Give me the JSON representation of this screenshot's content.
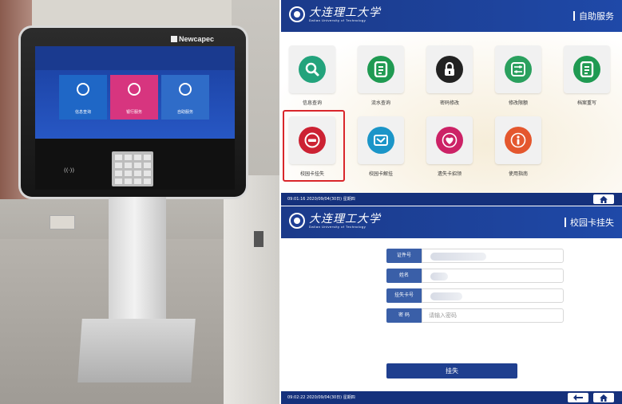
{
  "photo": {
    "brand": "Newcapec",
    "kiosk_tiles": [
      {
        "label": "信息查询",
        "color": "#1f67c6"
      },
      {
        "label": "银行服务",
        "color": "#d7357f"
      },
      {
        "label": "自助服务",
        "color": "#2f6cc8"
      }
    ],
    "nfc_label": "((·))"
  },
  "menu_screen": {
    "header": {
      "logo_cn": "大连理工大学",
      "logo_en": "Dalian University of Technology",
      "right_title": "自助服务"
    },
    "tiles": [
      {
        "label": "信息查询",
        "icon": "search-icon",
        "color": "#23a37c"
      },
      {
        "label": "流水查询",
        "icon": "document-icon",
        "color": "#1f9a52"
      },
      {
        "label": "密码修改",
        "icon": "lock-icon",
        "color": "#222222"
      },
      {
        "label": "修改限额",
        "icon": "sliders-icon",
        "color": "#2aa05e"
      },
      {
        "label": "档案重写",
        "icon": "document-icon",
        "color": "#1f9a52"
      },
      {
        "label": "校园卡挂失",
        "icon": "minus-circle-icon",
        "color": "#cc2233",
        "selected": true
      },
      {
        "label": "校园卡解挂",
        "icon": "mail-icon",
        "color": "#1b95c8"
      },
      {
        "label": "遗失卡招领",
        "icon": "heart-icon",
        "color": "#cc2266"
      },
      {
        "label": "使用指南",
        "icon": "info-icon",
        "color": "#e4572e"
      }
    ],
    "footer": {
      "timestamp": "09:01:16 2020/09/04(30日) 星期四",
      "home_icon": "home-icon"
    }
  },
  "form_screen": {
    "header": {
      "logo_cn": "大连理工大学",
      "logo_en": "Dalian University of Technology",
      "right_title": "校园卡挂失"
    },
    "fields": [
      {
        "label": "证件号",
        "value": "",
        "placeholder": "",
        "blurred": true
      },
      {
        "label": "姓名",
        "value": "",
        "placeholder": "",
        "blurred": true
      },
      {
        "label": "挂失卡号",
        "value": "",
        "placeholder": "",
        "blurred": true
      },
      {
        "label": "密 码",
        "value": "",
        "placeholder": "请输入密码",
        "blurred": false
      }
    ],
    "submit_label": "挂失",
    "footer": {
      "timestamp": "09:02:22 2020/09/04(30日) 星期四",
      "back_icon": "back-arrow-icon",
      "home_icon": "home-icon"
    }
  },
  "colors": {
    "header_blue": "#1b3a8a",
    "footer_blue": "#15317c",
    "label_blue": "#3a5fa8",
    "selected_red": "#d9262b"
  }
}
